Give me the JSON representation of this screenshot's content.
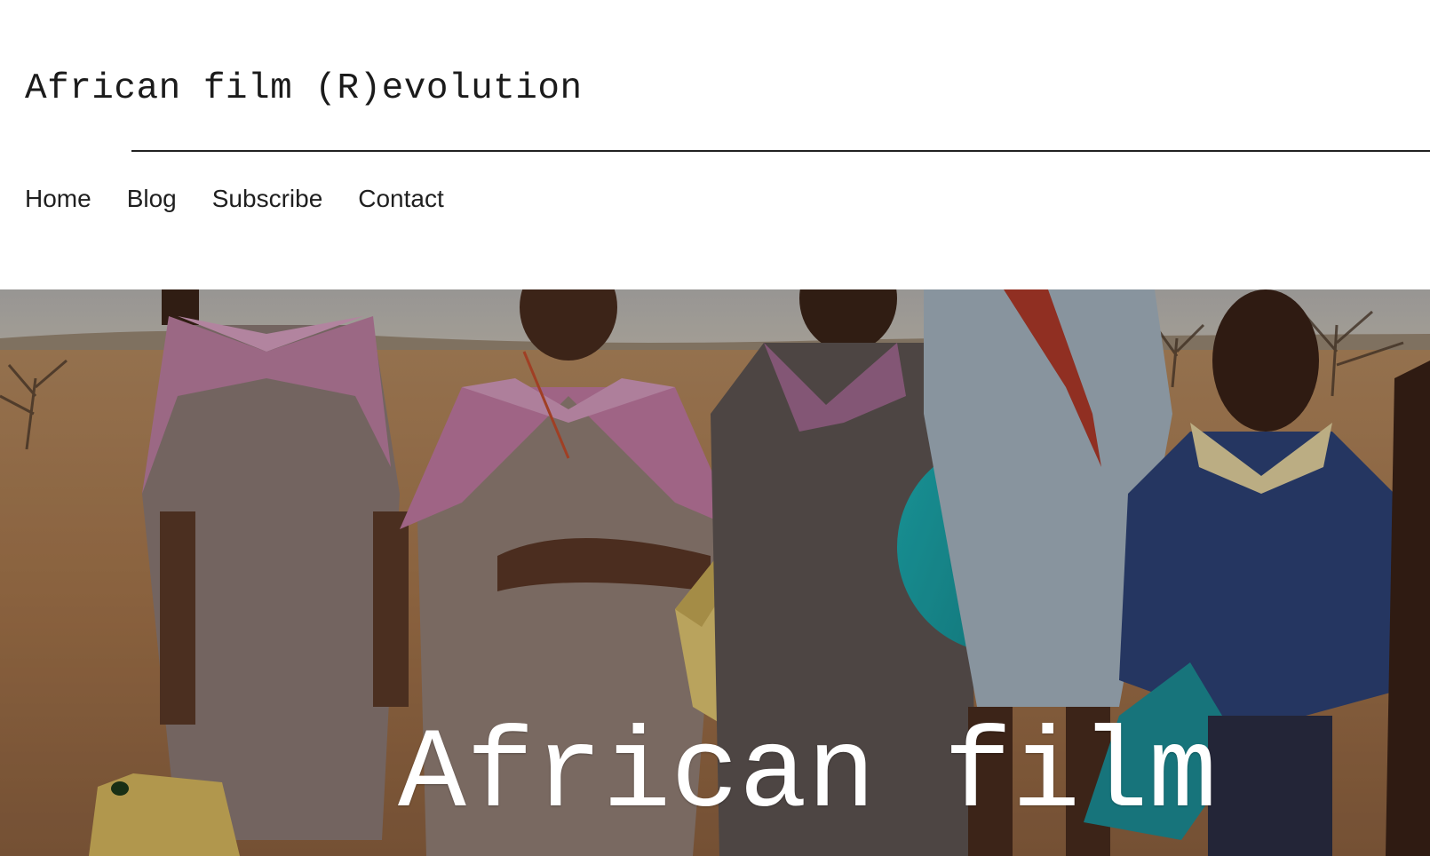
{
  "header": {
    "site_title": "African film (R)evolution"
  },
  "nav": {
    "items": [
      {
        "label": "Home"
      },
      {
        "label": "Blog"
      },
      {
        "label": "Subscribe"
      },
      {
        "label": "Contact"
      }
    ]
  },
  "hero": {
    "heading": "African film",
    "image": "photo of schoolchildren in pink collared uniforms holding water containers and a turquoise basin in a dry savanna landscape"
  },
  "colors": {
    "text": "#1b1b1b",
    "rule": "#222222",
    "hero_text": "#ffffff",
    "background": "#ffffff"
  }
}
